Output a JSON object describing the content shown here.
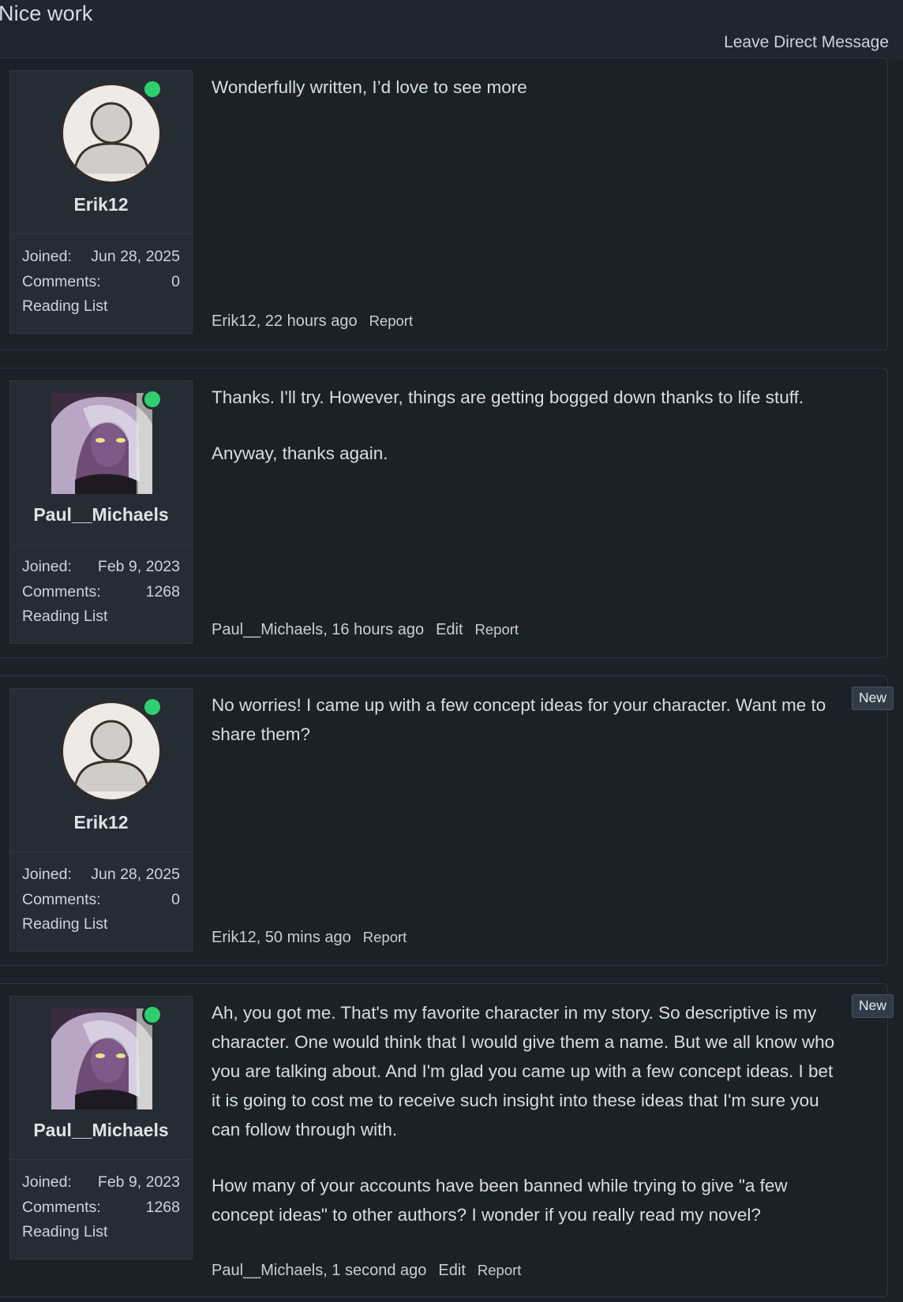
{
  "thread": {
    "title": "Nice work",
    "leave_dm_label": "Leave Direct Message"
  },
  "labels": {
    "joined": "Joined:",
    "comments": "Comments:",
    "reading_list": "Reading List",
    "edit": "Edit",
    "report": "Report",
    "new": "New"
  },
  "comments": [
    {
      "username": "Erik12",
      "avatar": "default-user-icon",
      "online": true,
      "joined": "Jun 28, 2025",
      "comment_count": "0",
      "paragraphs": [
        "Wonderfully written, I’d love to see more"
      ],
      "byline": "Erik12, 22 hours ago",
      "is_new": false
    },
    {
      "username": "Paul__Michaels",
      "avatar": "anime-portrait",
      "online": true,
      "joined": "Feb 9, 2023",
      "comment_count": "1268",
      "paragraphs": [
        "Thanks. I'll try. However, things are getting bogged down thanks to life stuff.",
        "Anyway, thanks again."
      ],
      "byline": "Paul__Michaels, 16 hours ago",
      "is_new": false
    },
    {
      "username": "Erik12",
      "avatar": "default-user-icon",
      "online": true,
      "joined": "Jun 28, 2025",
      "comment_count": "0",
      "paragraphs": [
        "No worries! I came up with a few concept ideas for your character. Want me to share them?"
      ],
      "byline": "Erik12, 50 mins ago",
      "is_new": true
    },
    {
      "username": "Paul__Michaels",
      "avatar": "anime-portrait",
      "online": true,
      "joined": "Feb 9, 2023",
      "comment_count": "1268",
      "paragraphs": [
        "Ah, you got me. That's my favorite character in my story. So descriptive is my character. One would think that I would give them a name. But we all know who you are talking about. And I'm glad you came up with a few concept ideas. I bet it is going to cost me to receive such insight into these ideas that I'm sure you can follow through with.",
        "How many of your accounts have been banned while trying to give \"a few concept ideas\" to other authors? I wonder if you really read my novel?"
      ],
      "byline": "Paul__Michaels, 1 second ago",
      "is_new": true
    }
  ],
  "colors": {
    "background": "#1c2127",
    "panel": "#262c33",
    "online": "#2fcf6f",
    "badge": "#313c48"
  }
}
